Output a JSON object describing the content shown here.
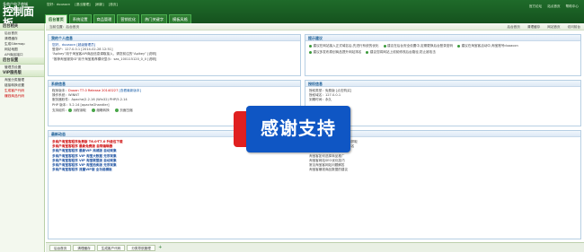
{
  "header": {
    "logo_small": "多商户电子商城",
    "logo_big": "控制面板",
    "userbar": [
      "您好：duoaocn",
      "[退出管理]",
      "[刷新]",
      "[首页]"
    ],
    "nav_tabs": [
      "后台首页",
      "系统设置",
      "商品管理",
      "营销优化",
      "热门关键字",
      "模板风格"
    ],
    "nav_active": 0,
    "topright": [
      "官方论坛",
      "站点首页",
      "帮助中心"
    ]
  },
  "sidebar": {
    "sections": [
      {
        "title": "后台相关",
        "items": [
          "后台首页",
          "清理缓存",
          "生成Sitemap",
          "网站地图",
          "API商品接口"
        ]
      },
      {
        "title": "后台设置",
        "items": [
          "管理员设置"
        ]
      },
      {
        "title": "VIP服务版",
        "items": [
          "淘宝分类管理",
          "链接转换设置",
          "生成客户代码",
          "赚钱商品代码"
        ]
      }
    ]
  },
  "toolbar": {
    "breadcrumb": "当前位置：后台首页",
    "links": [
      "后台首页",
      "清理缓存",
      "网站首页",
      "访问前台"
    ]
  },
  "panels": {
    "info": {
      "title": "我的个人信息",
      "lines": [
        "您好，duoaocn [超级管理员]",
        "登录IP：127.0.0.1 [2014-02-28 12:51]",
        "",
        "“Apikey”用于淘宝客API商品信息调取接入，请您前往的“Apikey” [说明]",
        "“推荐淘宝服务ID”用于淘宝推荐模块显示：sas_100115120_0_0 [说明]"
      ]
    },
    "tips": {
      "title": "提示建议",
      "rows": [
        [
          "建议在网站接入正式域名后,先进行系统的优化",
          "建议在后台安全设置中,定期更换后台登录密码",
          "建议在淘宝客活动中,淘宝账号duoaocn"
        ],
        [
          "建议多发布原创商品提升网站排名",
          "建议您将网站上线前修改后台路径,防止被攻击"
        ]
      ]
    },
    "sys": {
      "title": "系统信息",
      "version_label": "程序版本：",
      "version_value": "Duoan T7.0 Release 20140227",
      "version_tail": "[查看最新版本]",
      "lines": [
        "操作系统：WINNT",
        "服务器软件：Apache/2.2.16 (Win32) PHP/5.2.14",
        "PHP 版本：5.2.14 [apache2handler]"
      ],
      "checks_label": "支持组件：",
      "checks": [
        "远程读取",
        "缩略转换",
        "页面压缩"
      ]
    },
    "auth": {
      "title": "授权信息",
      "lines": [
        "授权类型：免费版 [点击购买]",
        "",
        "授权域名：127.0.0.1",
        "到期时间：永久"
      ]
    },
    "news": {
      "title": "最新动态",
      "left": [
        "多商户淘宝客程序免费版 T6.0-T7.0 升级包下载",
        "多商户淘宝客程序 最新免费版 自带编辑器",
        "多商户淘宝客程序 最新VIP 商城版 自动采集",
        "多商户淘宝客程序 VIP 淘宝大数据 无序采集",
        "多商户淘宝客程序 VIP 淘宝联盟版 自动采集",
        "多商户淘宝客程序 VIP 淘宝拍卖版 无序采集",
        "多商户淘宝客程序 流量VIP版 全功能模板"
      ],
      "right": [
        "如何让网站快速被百度收录和抓取",
        "如何提高网站在搜索引擎的排名",
        "淘宝客网站推广方法",
        "淘宝客如何选择商品推广",
        "淘宝客网站SEO优化技巧",
        "常见淘宝客网站问题解答",
        "淘宝客赚钱商品数据的建议"
      ]
    }
  },
  "bottom_tabs": [
    "后台首页",
    "清理缓存",
    "生成客户代码",
    "分类导航管理"
  ],
  "overlay": {
    "text": "感谢支持"
  }
}
